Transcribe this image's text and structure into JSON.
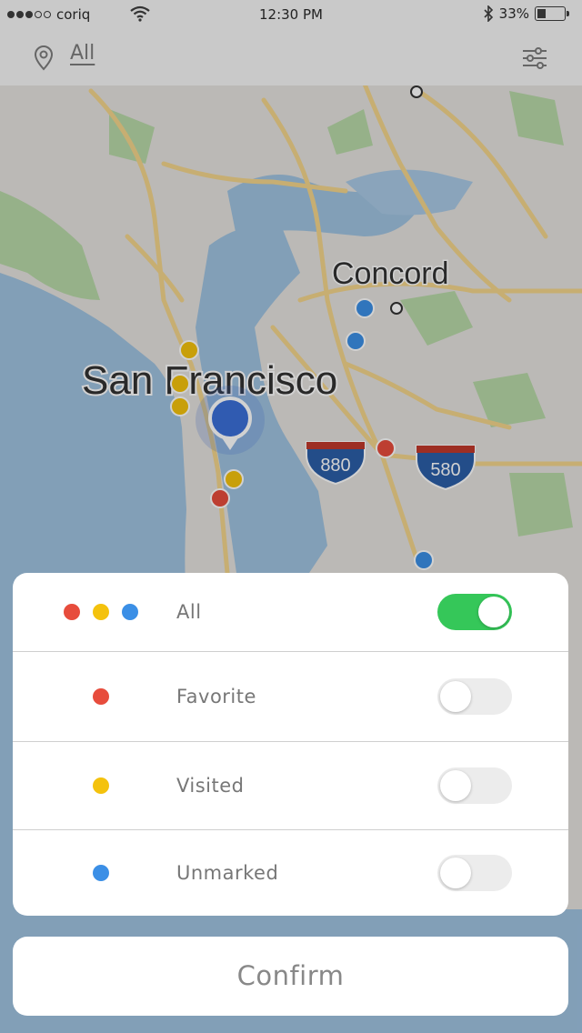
{
  "status_bar": {
    "carrier": "coriq",
    "time": "12:30 PM",
    "battery": "33%",
    "battery_level": 0.33,
    "signal_bars": 3,
    "signal_total": 5
  },
  "top_bar": {
    "filter_label": "All",
    "location_icon": "location-pin-icon",
    "settings_icon": "sliders-icon"
  },
  "map": {
    "labels": {
      "city_major": "San Francisco",
      "city_minor": "Concord",
      "highway_880": "880",
      "highway_580": "580"
    },
    "colors": {
      "water": "#9fc2e0",
      "land": "#e4e2de",
      "park": "#b8d8a8",
      "road": "#f3d58b"
    }
  },
  "sheet": {
    "rows": [
      {
        "label": "All",
        "colors": [
          "#e74c3c",
          "#f4c20d",
          "#3b8fe6"
        ],
        "toggle": true
      },
      {
        "label": "Favorite",
        "colors": [
          "#e74c3c"
        ],
        "toggle": false
      },
      {
        "label": "Visited",
        "colors": [
          "#f4c20d"
        ],
        "toggle": false
      },
      {
        "label": "Unmarked",
        "colors": [
          "#3b8fe6"
        ],
        "toggle": false
      }
    ]
  },
  "confirm_label": "Confirm",
  "colors": {
    "toggle_on": "#35c759",
    "toggle_off": "#ececec"
  }
}
